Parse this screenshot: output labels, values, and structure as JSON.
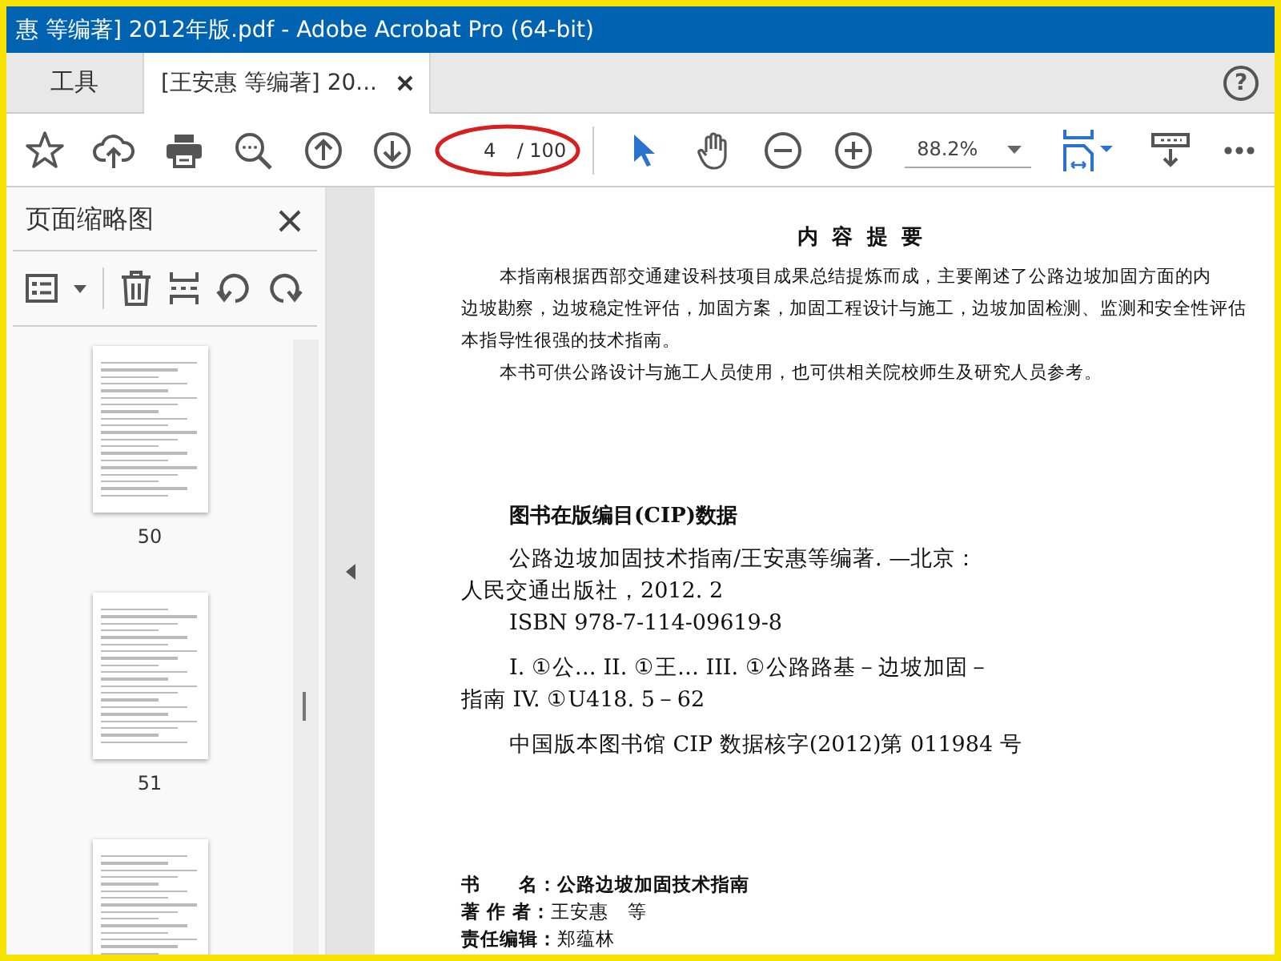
{
  "window": {
    "title": "惠 等编著] 2012年版.pdf - Adobe Acrobat Pro (64-bit)"
  },
  "tabs": [
    {
      "label": "工具",
      "selected": false,
      "closable": false
    },
    {
      "label": "[王安惠 等编著] 20...",
      "selected": true,
      "closable": true
    }
  ],
  "help_button": "?",
  "toolbar": {
    "tools": [
      {
        "kind": "star"
      },
      {
        "kind": "cloud"
      },
      {
        "kind": "print"
      },
      {
        "kind": "search"
      },
      {
        "kind": "up"
      },
      {
        "kind": "down"
      }
    ],
    "page_field": {
      "value": "4",
      "total": "/ 100",
      "annotated": true
    },
    "nav_tools": [
      {
        "kind": "pointer",
        "selected": true
      },
      {
        "kind": "hand",
        "selected": false
      },
      {
        "kind": "zoom-out"
      },
      {
        "kind": "zoom-in"
      }
    ],
    "zoom": "88.2%"
  },
  "sidebar": {
    "title": "页面缩略图",
    "thumbnails": [
      {
        "kind": "page",
        "label": "50"
      },
      {
        "kind": "page",
        "label": "51"
      },
      {
        "kind": "page"
      }
    ]
  },
  "document": {
    "heading": "内 容 提 要",
    "abstract_lines": [
      {
        "text": "本指南根据西部交通建设科技项目成果总结提炼而成，主要阐述了公路边坡加固方面的内",
        "indent": true
      },
      {
        "text": "边坡勘察，边坡稳定性评估，加固方案，加固工程设计与施工，边坡加固检测、监测和安全性评估",
        "indent": false
      },
      {
        "text": "本指导性很强的技术指南。",
        "indent": false
      },
      {
        "text": "本书可供公路设计与施工人员使用，也可供相关院校师生及研究人员参考。",
        "indent": true
      }
    ],
    "cip_heading": "图书在版编目(CIP)数据",
    "cip_lines": [
      {
        "text": "公路边坡加固技术指南/王安惠等编著. —北京：",
        "indent": true,
        "gap": false
      },
      {
        "text": "人民交通出版社，2012. 2",
        "indent": false,
        "gap": false
      },
      {
        "text": "ISBN  978-7-114-09619-8",
        "indent": true,
        "gap": false
      },
      {
        "text": "I. ①公…   II. ①王…   III. ①公路路基－边坡加固－",
        "indent": true,
        "gap": true
      },
      {
        "text": "指南   IV. ①U418. 5－62",
        "indent": false,
        "gap": false
      },
      {
        "text": "中国版本图书馆 CIP 数据核字(2012)第 011984 号",
        "indent": true,
        "gap": true
      }
    ],
    "book_info": [
      {
        "label": "书　　名：",
        "value": "公路边坡加固技术指南",
        "bold": true
      },
      {
        "label": "著 作 者：",
        "value": "王安惠　等",
        "bold": false
      },
      {
        "label": "责任编辑：",
        "value": "郑蕴林",
        "bold": false
      }
    ]
  }
}
